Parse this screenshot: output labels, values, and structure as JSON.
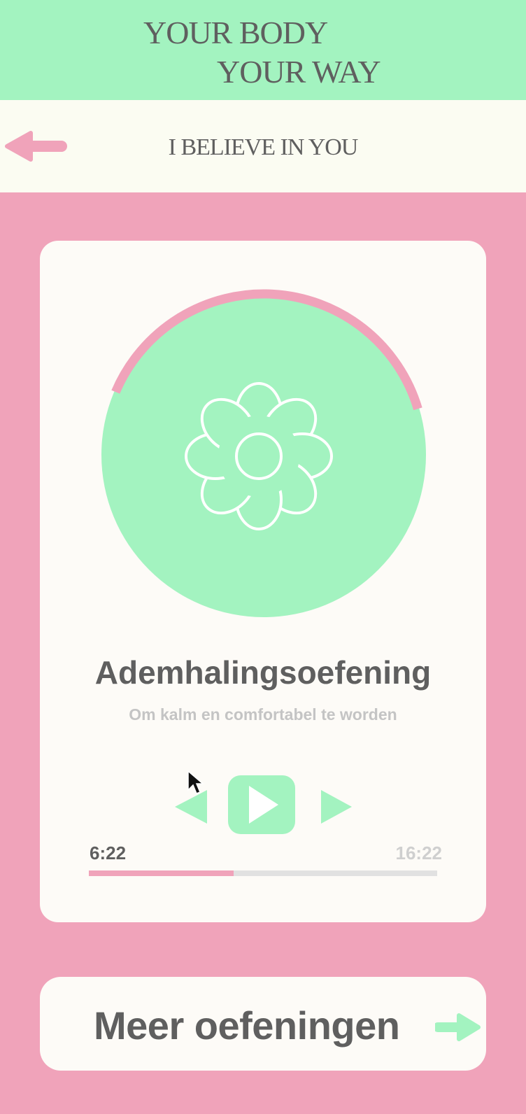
{
  "header": {
    "brand_line_1": "YOUR BODY",
    "brand_line_2": "YOUR WAY"
  },
  "subheader": {
    "title": "I BELIEVE IN YOU",
    "back_icon": "arrow-left-icon"
  },
  "player": {
    "icon": "flower-icon",
    "title": "Ademhalingsoefening",
    "subtitle": "Om kalm en comfortabel te worden",
    "controls": {
      "previous_icon": "previous-icon",
      "play_icon": "play-icon",
      "next_icon": "next-icon"
    },
    "elapsed": "6:22",
    "total": "16:22",
    "progress_fraction": 0.416,
    "ring_progress_fraction": 0.39
  },
  "more": {
    "label": "Meer oefeningen",
    "arrow_icon": "arrow-right-icon"
  },
  "colors": {
    "mint": "#a3f3c0",
    "pink": "#f0a3ba",
    "cream": "#fdfbf7",
    "text": "#5f5f5f",
    "muted": "#c4c4c4"
  }
}
